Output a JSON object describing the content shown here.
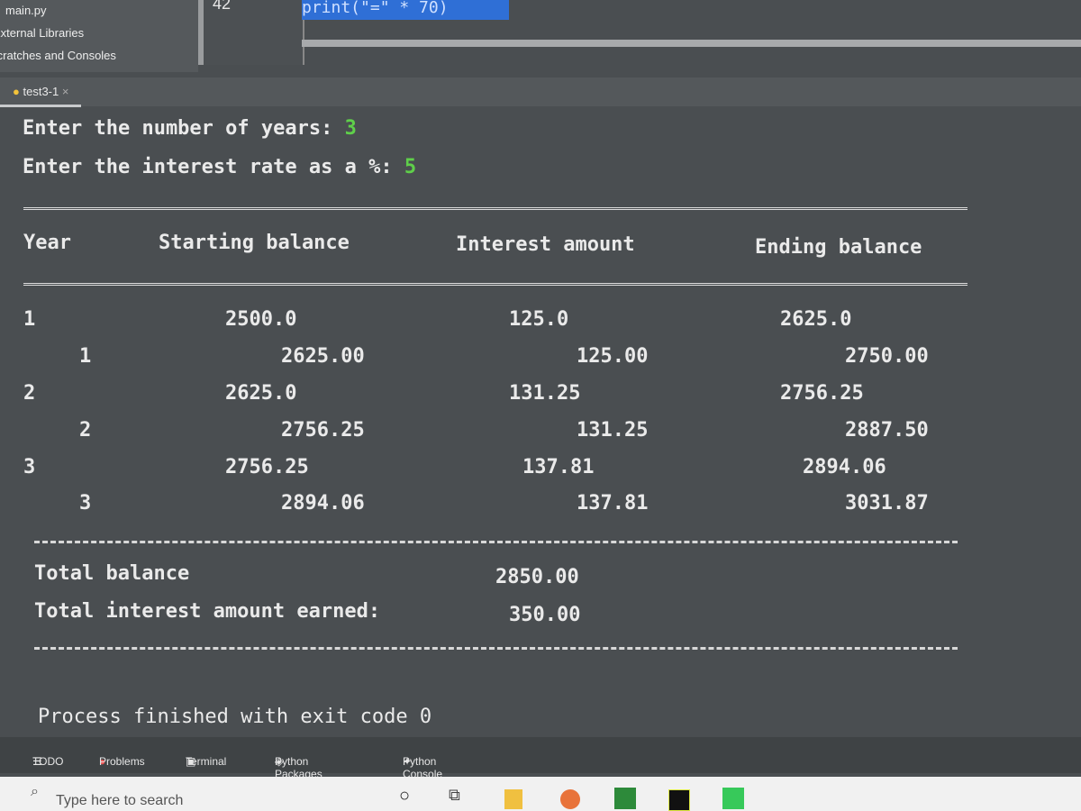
{
  "project": {
    "items": [
      "main.py",
      "External Libraries",
      "Scratches and Consoles"
    ]
  },
  "editor": {
    "line_number": "42",
    "code": "print(\"=\" * 70)"
  },
  "run_tab": {
    "label": "test3-1",
    "close": "×"
  },
  "console": {
    "prompt_years": "Enter the number of years:",
    "years": "3",
    "prompt_rate": "Enter the interest rate as a %:",
    "rate": "5",
    "headers": [
      "Year",
      "Starting balance",
      "Interest amount",
      "Ending balance"
    ],
    "rows": [
      {
        "year": "1",
        "start": "2500.0",
        "interest": "125.0",
        "end": "2625.0"
      },
      {
        "year": "1",
        "start": "2625.00",
        "interest": "125.00",
        "end": "2750.00"
      },
      {
        "year": "2",
        "start": "2625.0",
        "interest": "131.25",
        "end": "2756.25"
      },
      {
        "year": "2",
        "start": "2756.25",
        "interest": "131.25",
        "end": "2887.50"
      },
      {
        "year": "3",
        "start": "2756.25",
        "interest": "137.81",
        "end": "2894.06"
      },
      {
        "year": "3",
        "start": "2894.06",
        "interest": "137.81",
        "end": "3031.87"
      }
    ],
    "total_balance_label": "Total balance",
    "total_balance": "2850.00",
    "total_interest_label": "Total interest amount earned:",
    "total_interest": "350.00",
    "exit_message": "Process finished with exit code 0"
  },
  "toolwindows": [
    "TODO",
    "Problems",
    "Terminal",
    "Python Packages",
    "Python Console"
  ],
  "taskbar": {
    "search_placeholder": "Type here to search"
  }
}
